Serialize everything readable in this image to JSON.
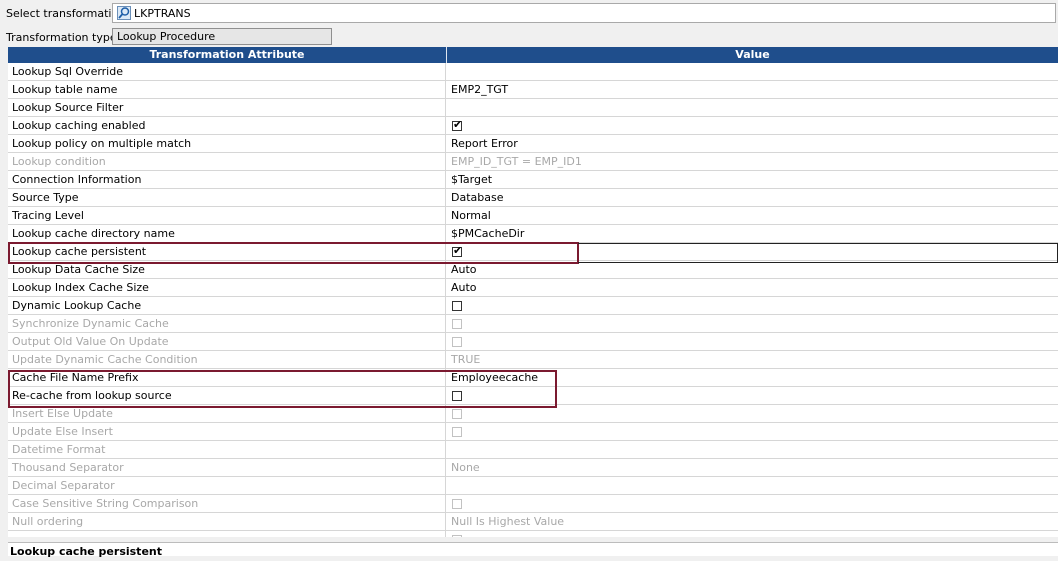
{
  "select_transformation": {
    "label": "Select transformation:",
    "value": "LKPTRANS",
    "icon": "lookup-icon"
  },
  "transformation_type": {
    "label": "Transformation type:",
    "value": "Lookup Procedure"
  },
  "grid": {
    "headers": {
      "attribute": "Transformation Attribute",
      "value": "Value"
    },
    "header_color": "#1f4e8c",
    "highlight_color": "#7b1a30",
    "rows": [
      {
        "name": "Lookup Sql Override",
        "value": "",
        "type": "text",
        "enabled": true
      },
      {
        "name": "Lookup table name",
        "value": "EMP2_TGT",
        "type": "text",
        "enabled": true
      },
      {
        "name": "Lookup Source Filter",
        "value": "",
        "type": "text",
        "enabled": true
      },
      {
        "name": "Lookup caching enabled",
        "value": "",
        "type": "checkbox",
        "checked": true,
        "enabled": true
      },
      {
        "name": "Lookup policy on multiple match",
        "value": "Report Error",
        "type": "text",
        "enabled": true
      },
      {
        "name": "Lookup condition",
        "value": "EMP_ID_TGT = EMP_ID1",
        "type": "text",
        "enabled": false
      },
      {
        "name": "Connection Information",
        "value": "$Target",
        "type": "text",
        "enabled": true
      },
      {
        "name": "Source Type",
        "value": "Database",
        "type": "text",
        "enabled": true
      },
      {
        "name": "Tracing Level",
        "value": "Normal",
        "type": "text",
        "enabled": true
      },
      {
        "name": "Lookup cache directory name",
        "value": "$PMCacheDir",
        "type": "text",
        "enabled": true
      },
      {
        "name": "Lookup cache persistent",
        "value": "",
        "type": "checkbox",
        "checked": true,
        "enabled": true
      },
      {
        "name": "Lookup Data Cache Size",
        "value": "Auto",
        "type": "text",
        "enabled": true
      },
      {
        "name": "Lookup Index Cache Size",
        "value": "Auto",
        "type": "text",
        "enabled": true
      },
      {
        "name": "Dynamic Lookup Cache",
        "value": "",
        "type": "checkbox",
        "checked": false,
        "enabled": true
      },
      {
        "name": "Synchronize Dynamic Cache",
        "value": "",
        "type": "checkbox",
        "checked": false,
        "enabled": false
      },
      {
        "name": "Output Old Value On Update",
        "value": "",
        "type": "checkbox",
        "checked": false,
        "enabled": false
      },
      {
        "name": "Update Dynamic Cache Condition",
        "value": "TRUE",
        "type": "text",
        "enabled": false
      },
      {
        "name": "Cache File Name Prefix",
        "value": "Employeecache",
        "type": "text",
        "enabled": true
      },
      {
        "name": "Re-cache from lookup source",
        "value": "",
        "type": "checkbox",
        "checked": false,
        "enabled": true
      },
      {
        "name": "Insert Else Update",
        "value": "",
        "type": "checkbox",
        "checked": false,
        "enabled": false
      },
      {
        "name": "Update Else Insert",
        "value": "",
        "type": "checkbox",
        "checked": false,
        "enabled": false
      },
      {
        "name": "Datetime Format",
        "value": "",
        "type": "text",
        "enabled": false
      },
      {
        "name": "Thousand Separator",
        "value": "None",
        "type": "text",
        "enabled": false
      },
      {
        "name": "Decimal Separator",
        "value": "",
        "type": "text",
        "enabled": false
      },
      {
        "name": "Case Sensitive String Comparison",
        "value": "",
        "type": "checkbox",
        "checked": false,
        "enabled": false
      },
      {
        "name": "Null ordering",
        "value": "Null Is Highest Value",
        "type": "text",
        "enabled": false
      },
      {
        "name": "",
        "value": "",
        "type": "checkbox",
        "checked": false,
        "enabled": false
      }
    ]
  },
  "status_bar": {
    "text": "Lookup cache persistent"
  }
}
